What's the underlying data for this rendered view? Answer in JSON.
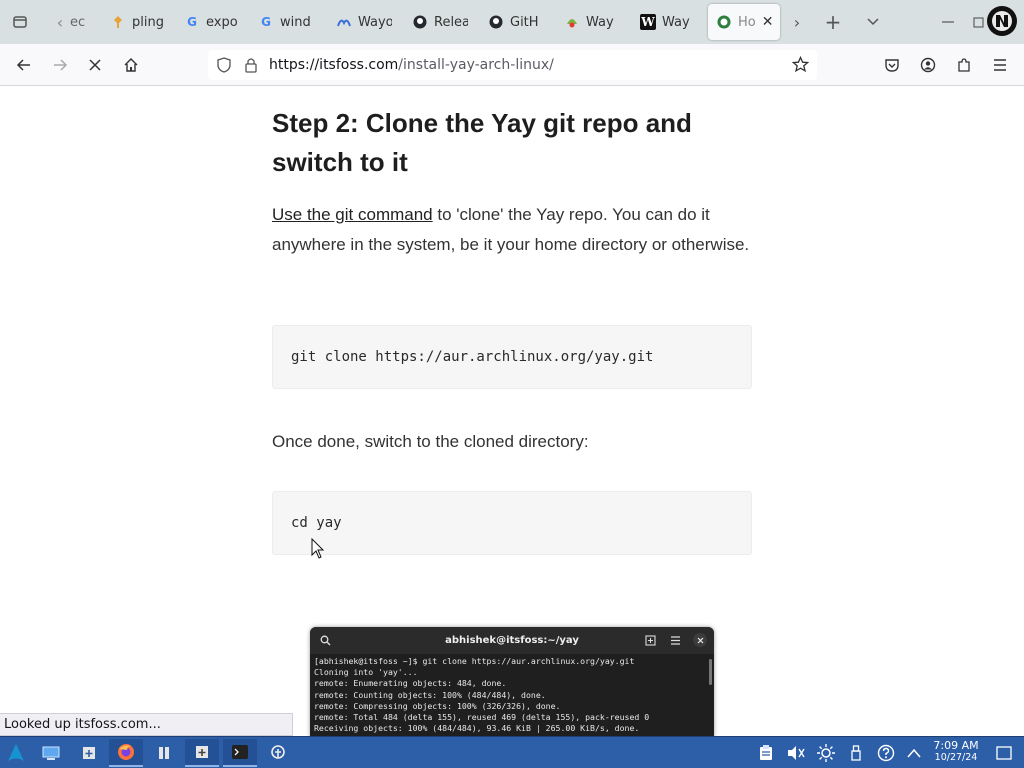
{
  "browser": {
    "tabs": [
      {
        "title": "ec",
        "icon": "tab-overflow-icon"
      },
      {
        "title": "pling",
        "icon": "pling-icon"
      },
      {
        "title": "expo",
        "icon": "google-icon"
      },
      {
        "title": "wind",
        "icon": "google-icon"
      },
      {
        "title": "Wayo",
        "icon": "wayland-icon"
      },
      {
        "title": "Relea",
        "icon": "github-icon"
      },
      {
        "title": "GitH",
        "icon": "github-icon"
      },
      {
        "title": "Way",
        "icon": "wayland-icon"
      },
      {
        "title": "Way",
        "icon": "wikipedia-icon"
      },
      {
        "title": "Ho",
        "icon": "itsfoss-icon",
        "active": true
      }
    ],
    "tab_icon_glyphs": {
      "google": "G",
      "wiki": "W"
    },
    "url": {
      "host": "https://itsfoss.com",
      "path": "/install-yay-arch-linux/"
    },
    "status_text": "Looked up itsfoss.com..."
  },
  "article": {
    "heading": "Step 2: Clone the Yay git repo and switch to it",
    "para1_link": "Use the git command",
    "para1_rest": " to 'clone' the Yay repo. You can do it anywhere in the system, be it your home directory or otherwise.",
    "code1": "git clone https://aur.archlinux.org/yay.git",
    "para2": "Once done, switch to the cloned directory:",
    "code2": "cd yay"
  },
  "terminal": {
    "title": "abhishek@itsfoss:~/yay",
    "lines": [
      "[abhishek@itsfoss ~]$ git clone https://aur.archlinux.org/yay.git",
      "Cloning into 'yay'...",
      "remote: Enumerating objects: 484, done.",
      "remote: Counting objects: 100% (484/484), done.",
      "remote: Compressing objects: 100% (326/326), done.",
      "remote: Total 484 (delta 155), reused 469 (delta 155), pack-reused 0",
      "Receiving objects: 100% (484/484), 93.46 KiB | 265.00 KiB/s, done."
    ]
  },
  "taskbar": {
    "time": "7:09 AM",
    "date": "10/27/24"
  }
}
